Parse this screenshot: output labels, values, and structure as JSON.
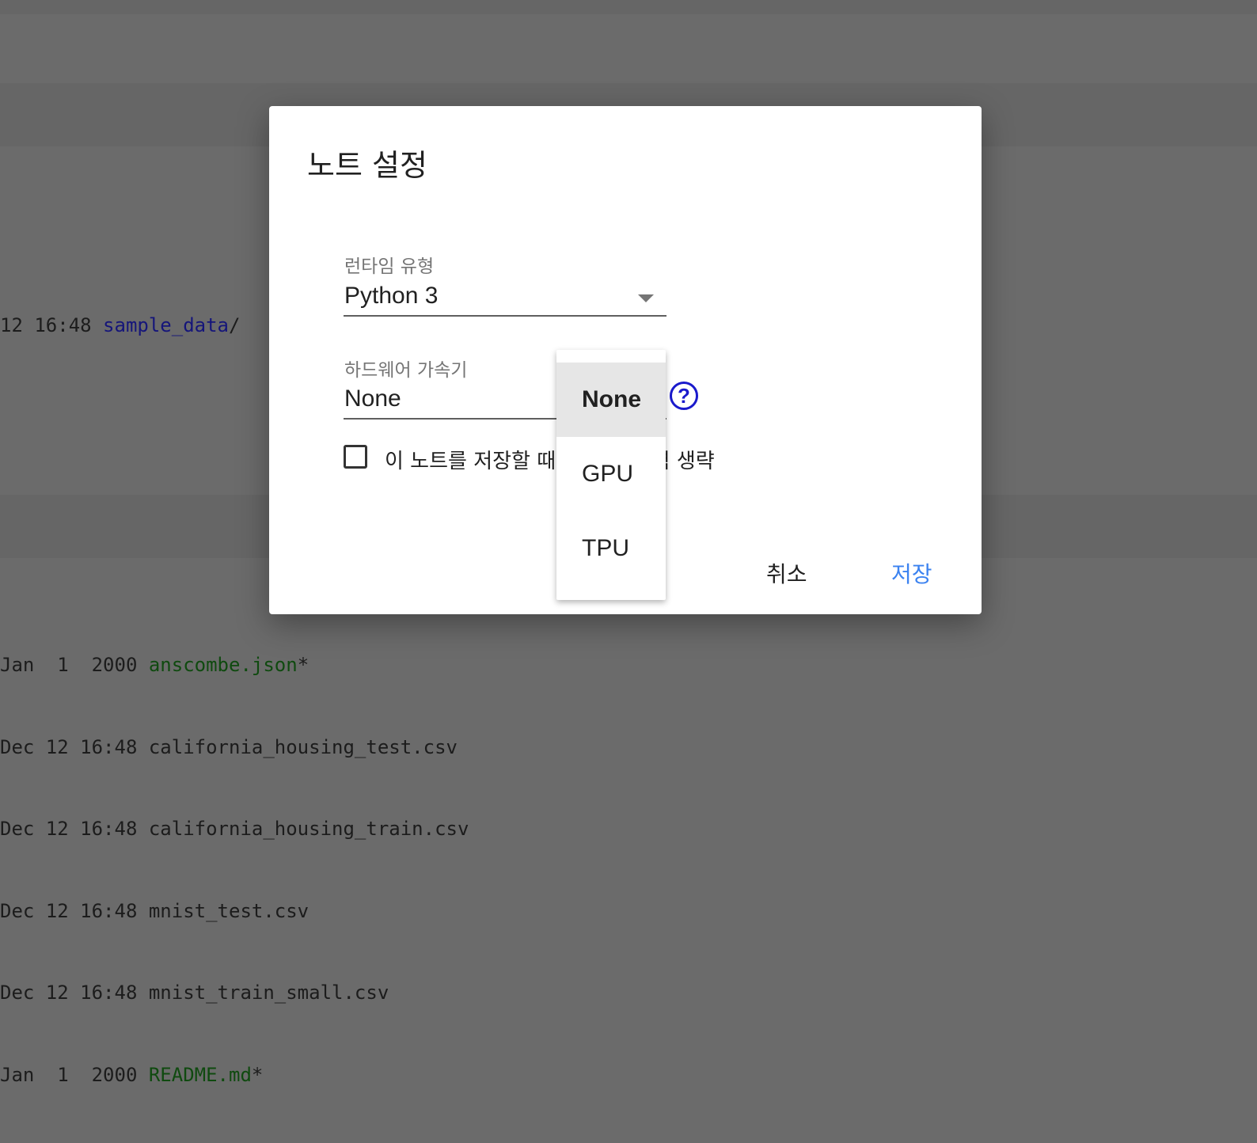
{
  "terminal": {
    "top_line": {
      "prefix": "12 16:48 ",
      "name": "sample_data",
      "suffix": "/"
    },
    "listing": [
      {
        "prefix": "Jan  1  2000 ",
        "name": "anscombe.json",
        "kind": "exe",
        "suffix": "*"
      },
      {
        "prefix": "Dec 12 16:48 ",
        "name": "california_housing_test.csv",
        "kind": "file",
        "suffix": ""
      },
      {
        "prefix": "Dec 12 16:48 ",
        "name": "california_housing_train.csv",
        "kind": "file",
        "suffix": ""
      },
      {
        "prefix": "Dec 12 16:48 ",
        "name": "mnist_test.csv",
        "kind": "file",
        "suffix": ""
      },
      {
        "prefix": "Dec 12 16:48 ",
        "name": "mnist_train_small.csv",
        "kind": "file",
        "suffix": ""
      },
      {
        "prefix": "Jan  1  2000 ",
        "name": "README.md",
        "kind": "exe",
        "suffix": "*"
      }
    ]
  },
  "dialog": {
    "title": "노트 설정",
    "runtime": {
      "label": "런타임 유형",
      "value": "Python 3"
    },
    "accelerator": {
      "label": "하드웨어 가속기",
      "value": "None",
      "help_glyph": "?",
      "options": [
        "None",
        "GPU",
        "TPU"
      ],
      "selected": "None"
    },
    "omit_output": {
      "label": "이 노트를 저장할 때 코드 셀 출력 생략",
      "checked": false
    },
    "cancel_label": "취소",
    "save_label": "저장"
  },
  "colors": {
    "backdrop": "#6b6b6b",
    "save_blue": "#3b82f0",
    "help_blue": "#1a1acc",
    "selected_item_bg": "#e6e6e6"
  }
}
